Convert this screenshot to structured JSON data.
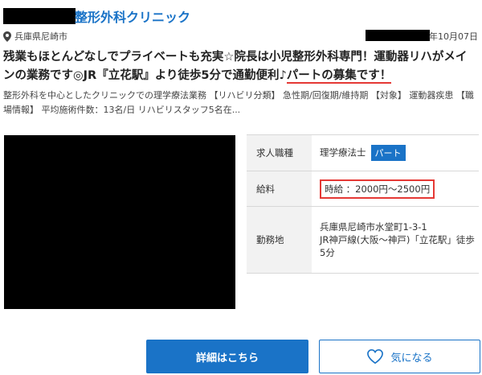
{
  "listing": {
    "clinic_name": "整形外科クリニック",
    "location": "兵庫県尼崎市",
    "date": "年10月07日",
    "headline_part1": "残業もほとんどなしでプライベートも充実☆院長は小児整形外科専門！運動器リハがメインの業務です◎JR『立花駅』より徒歩5分で通勤便利♪",
    "headline_part2": "パートの募集です！",
    "description": "整形外科を中心としたクリニックでの理学療法業務 【リハビリ分類】 急性期/回復期/維持期 【対象】 運動器疾患 【職場情報】 平均施術件数：13名/日 リハビリスタッフ5名在..."
  },
  "details": {
    "job_type_label": "求人職種",
    "job_type_value": "理学療法士",
    "employment_badge": "パート",
    "salary_label": "給料",
    "salary_value": "時給 ：2000円～2500円",
    "workplace_label": "勤務地",
    "address_line1": "兵庫県尼崎市水堂町1-3-1",
    "address_line2": "JR神戸線(大阪～神戸)「立花駅」徒歩 5分"
  },
  "actions": {
    "detail_button": "詳細はこちら",
    "favorite_button": "気になる"
  },
  "icons": {
    "location": "map-pin-icon",
    "favorite": "heart-icon"
  },
  "colors": {
    "accent": "#1a73c7",
    "highlight": "#e53935"
  }
}
